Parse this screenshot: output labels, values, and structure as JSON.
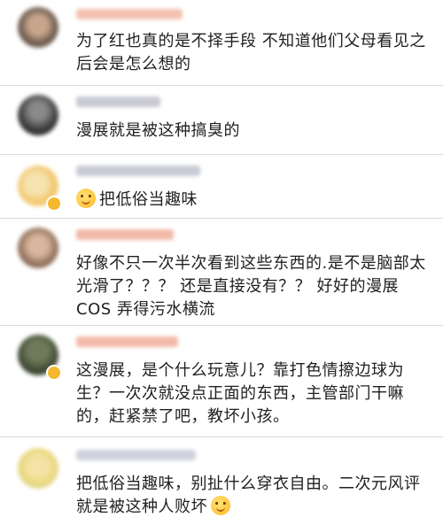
{
  "comments": [
    {
      "text": "为了红也真的是不择手段 不知道他们父母看见之后会是怎么想的"
    },
    {
      "text": "漫展就是被这种搞臭的"
    },
    {
      "text": "把低俗当趣味",
      "emoji": "tongue-smile-emoji"
    },
    {
      "text": "好像不只一次半次看到这些东西的.是不是脑部太光滑了？？？ 还是直接没有？？ 好好的漫展 COS 弄得污水横流"
    },
    {
      "text": "这漫展，是个什么玩意儿？靠打色情擦边球为生？一次次就没点正面的东西，主管部门干嘛的，赶紧禁了吧，教坏小孩。"
    },
    {
      "text": "把低俗当趣味，别扯什么穿衣自由。二次元风评就是被这种人败坏",
      "emoji": "tongue-smile-emoji"
    }
  ],
  "colors": {
    "divider": "#d9d9d9",
    "text": "#1f1f1f",
    "name_blur": "#f2b9a8",
    "badge": "#f5b82e"
  }
}
